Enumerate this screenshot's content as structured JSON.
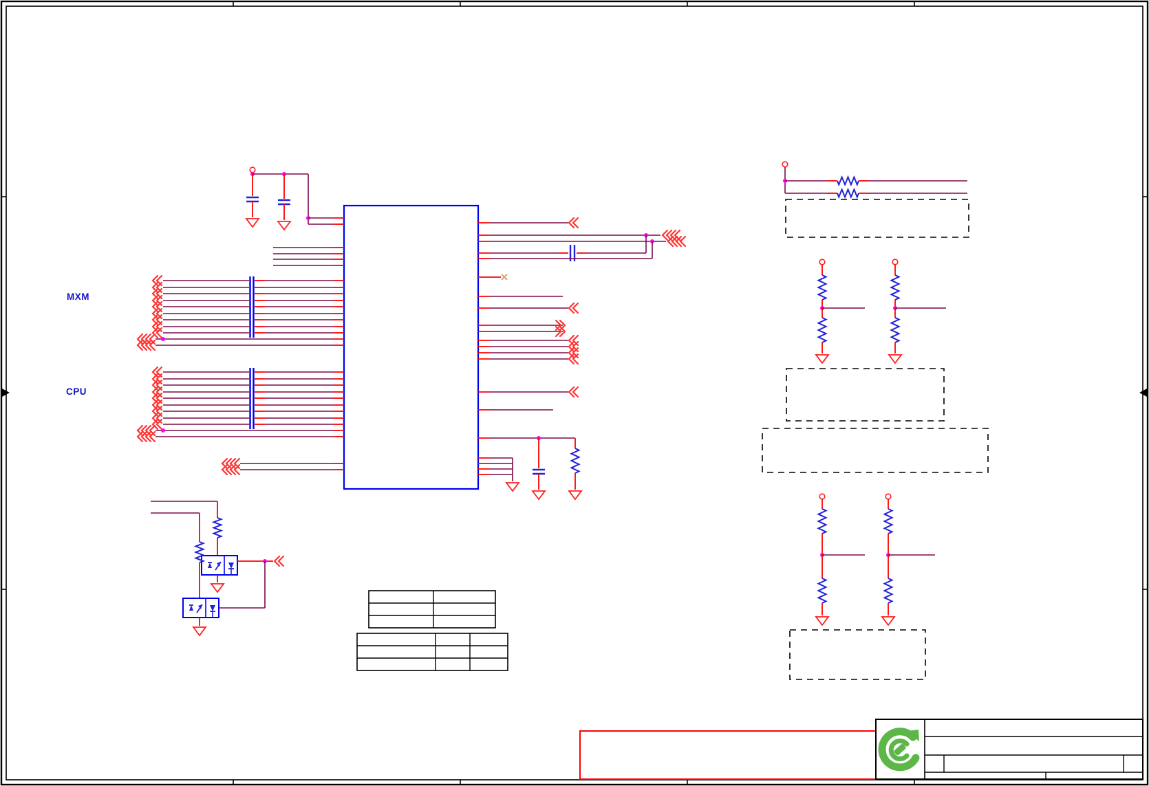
{
  "sheet": {
    "labels": {
      "mxm": "MXM",
      "cpu": "CPU"
    },
    "colors": {
      "wire": "#7a0a4a",
      "pin": "#ff0000",
      "ic_outline": "#0000f0",
      "symbol_blue": "#2222d8",
      "connector_red": "#ff3333",
      "junction": "#ff00ff",
      "power_red": "#ff2020",
      "ground_red": "#ff2020",
      "no_connect": "#d8a878",
      "frame_black": "#000000",
      "eco_box_red": "#ff0000",
      "logo_green": "#5cb648"
    },
    "legend": {
      "component_symbols": [
        "ic-block",
        "resistor",
        "capacitor",
        "dual-mosfet-package",
        "ground-symbol",
        "power-port",
        "off-page-connector",
        "junction-dot",
        "no-connect",
        "bus-entry-bars",
        "dashed-note-box",
        "revision-table",
        "eco-note-box",
        "title-block",
        "vendor-logo",
        "sheet-zone-tick",
        "sheet-center-arrow"
      ]
    }
  }
}
